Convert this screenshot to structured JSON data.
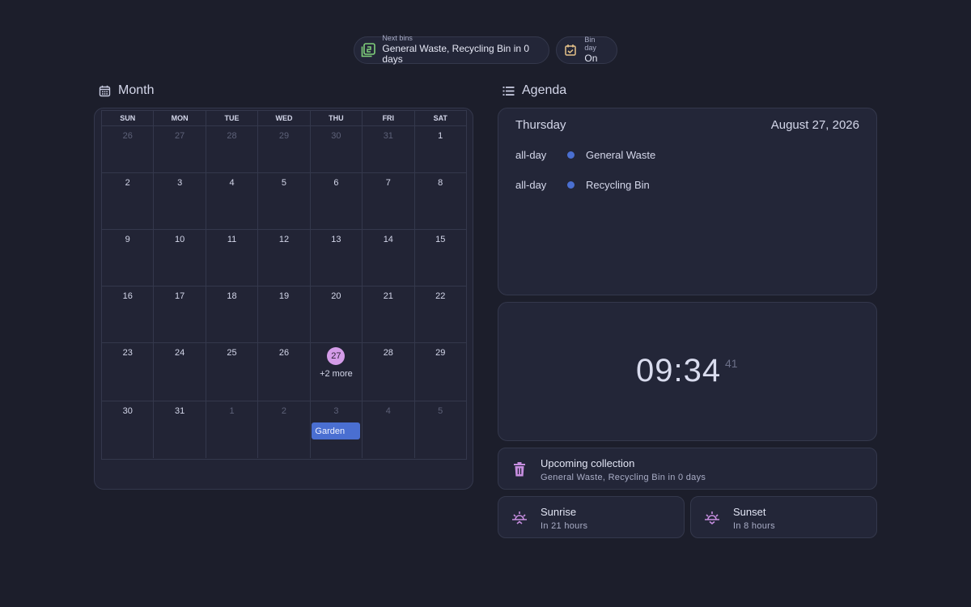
{
  "chips": {
    "next_bins": {
      "label": "Next bins",
      "value": "General Waste, Recycling Bin in 0 days",
      "icon": "recycle-bin-icon",
      "icon_color": "#7fcf7a"
    },
    "bin_day": {
      "label": "Bin day",
      "value": "On",
      "icon": "calendar-check-icon",
      "icon_color": "#e8c48a"
    }
  },
  "month": {
    "title": "Month",
    "weekdays": [
      "SUN",
      "MON",
      "TUE",
      "WED",
      "THU",
      "FRI",
      "SAT"
    ],
    "weeks": [
      [
        {
          "d": "26",
          "m": true
        },
        {
          "d": "27",
          "m": true
        },
        {
          "d": "28",
          "m": true
        },
        {
          "d": "29",
          "m": true
        },
        {
          "d": "30",
          "m": true
        },
        {
          "d": "31",
          "m": true
        },
        {
          "d": "1"
        }
      ],
      [
        {
          "d": "2"
        },
        {
          "d": "3"
        },
        {
          "d": "4"
        },
        {
          "d": "5"
        },
        {
          "d": "6"
        },
        {
          "d": "7"
        },
        {
          "d": "8"
        }
      ],
      [
        {
          "d": "9"
        },
        {
          "d": "10"
        },
        {
          "d": "11"
        },
        {
          "d": "12"
        },
        {
          "d": "13"
        },
        {
          "d": "14"
        },
        {
          "d": "15"
        }
      ],
      [
        {
          "d": "16"
        },
        {
          "d": "17"
        },
        {
          "d": "18"
        },
        {
          "d": "19"
        },
        {
          "d": "20"
        },
        {
          "d": "21"
        },
        {
          "d": "22"
        }
      ],
      [
        {
          "d": "23"
        },
        {
          "d": "24"
        },
        {
          "d": "25"
        },
        {
          "d": "26"
        },
        {
          "d": "27",
          "today": true,
          "more": "+2 more"
        },
        {
          "d": "28"
        },
        {
          "d": "29"
        }
      ],
      [
        {
          "d": "30"
        },
        {
          "d": "31"
        },
        {
          "d": "1",
          "m": true
        },
        {
          "d": "2",
          "m": true
        },
        {
          "d": "3",
          "m": true,
          "event": "Garden"
        },
        {
          "d": "4",
          "m": true
        },
        {
          "d": "5",
          "m": true
        }
      ]
    ]
  },
  "agenda": {
    "title": "Agenda",
    "day": "Thursday",
    "date": "August 27, 2026",
    "events": [
      {
        "when": "all-day",
        "name": "General Waste"
      },
      {
        "when": "all-day",
        "name": "Recycling Bin"
      }
    ]
  },
  "clock": {
    "time": "09:34",
    "seconds": "41"
  },
  "upcoming": {
    "title": "Upcoming collection",
    "subtitle": "General Waste, Recycling Bin in 0 days",
    "icon": "trash-icon"
  },
  "sunrise": {
    "title": "Sunrise",
    "subtitle": "In 21 hours",
    "icon": "sunrise-icon"
  },
  "sunset": {
    "title": "Sunset",
    "subtitle": "In 8 hours",
    "icon": "sunset-icon"
  },
  "colors": {
    "background": "#1c1e2b",
    "card": "#232638",
    "accent_purple": "#d49ce8",
    "event_blue": "#4a6fd1"
  }
}
